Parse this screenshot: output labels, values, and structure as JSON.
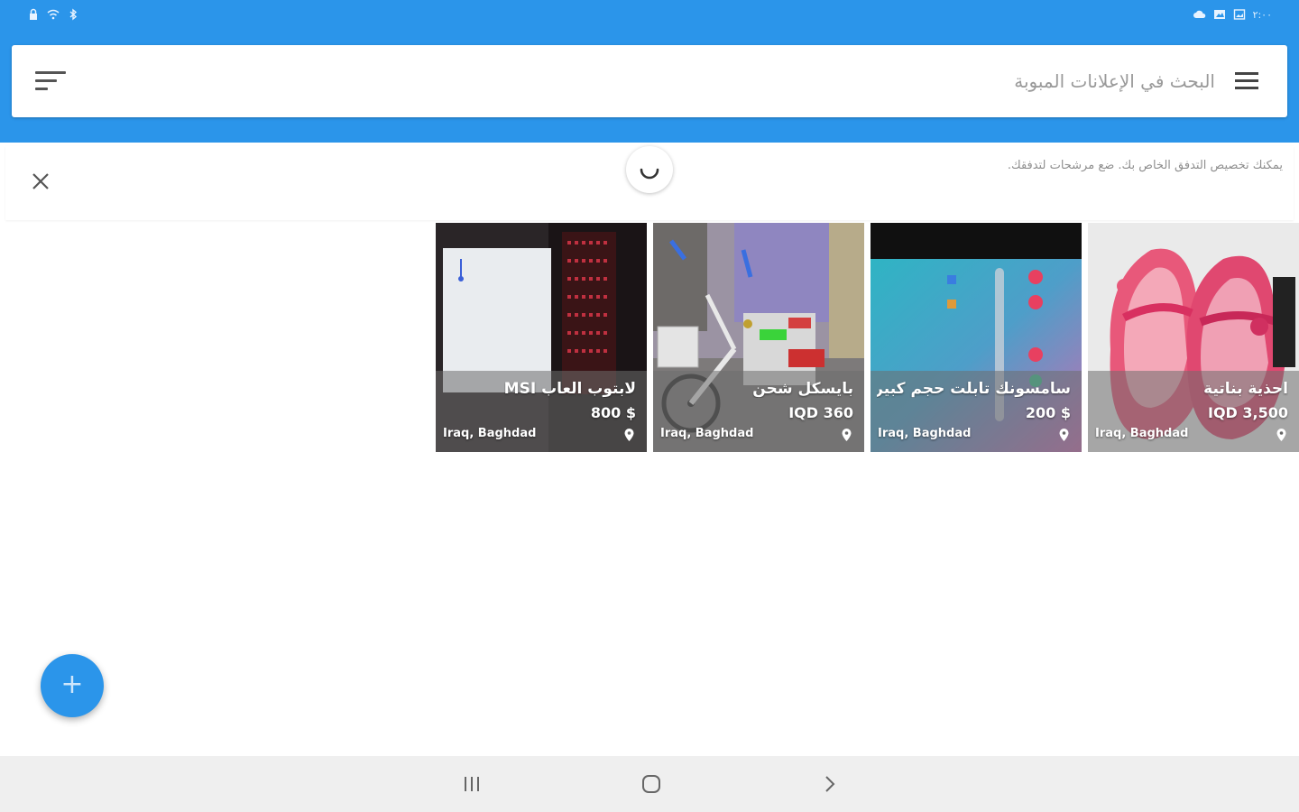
{
  "status_bar": {
    "left_icons": [
      "lock-icon",
      "wifi-icon",
      "bluetooth-icon"
    ],
    "right_icons": [
      "cloud-icon",
      "gallery-icon",
      "image-icon"
    ],
    "right_text": "۲:۰۰"
  },
  "search": {
    "placeholder": "البحث في الإعلانات المبوبة",
    "filter_icon": "filter-sort-icon",
    "menu_icon": "hamburger-menu-icon"
  },
  "notice": {
    "text": "يمكنك تخصيص التدفق الخاص بك. ضع مرشحات لتدفقك.",
    "close_icon": "close-icon",
    "loading_icon": "spinner-icon"
  },
  "listings": [
    {
      "title": "لابتوب العاب MSI",
      "price": "800 $",
      "location": "Iraq, Baghdad",
      "image": "laptop-photo"
    },
    {
      "title": "بايسكل شحن",
      "price": "IQD 360",
      "location": "Iraq, Baghdad",
      "image": "tricycle-photo"
    },
    {
      "title": "سامسونك تابلت حجم كبير 1...",
      "price": "200 $",
      "location": "Iraq, Baghdad",
      "image": "tablet-photo"
    },
    {
      "title": "احذية بناتية",
      "price": "IQD 3,500",
      "location": "Iraq, Baghdad",
      "image": "pink-shoes-photo"
    }
  ],
  "fab": {
    "label": "+"
  },
  "colors": {
    "primary": "#2b95ea",
    "nav_bar": "#efefef"
  },
  "nav": [
    "recent-apps-icon",
    "home-icon",
    "back-icon"
  ]
}
